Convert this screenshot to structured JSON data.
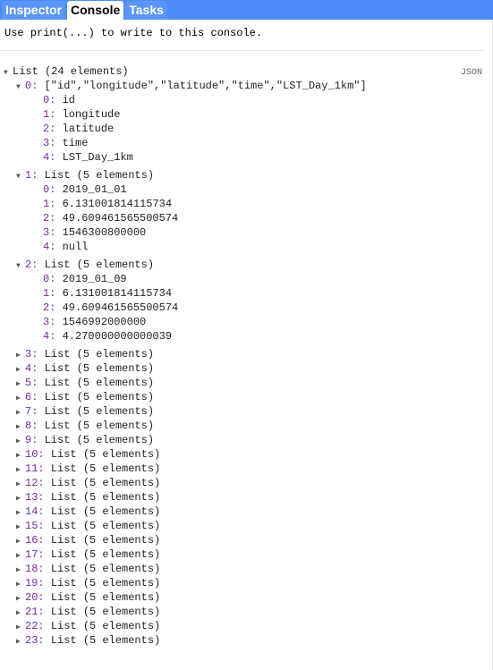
{
  "tabs": [
    {
      "label": "Inspector",
      "active": false
    },
    {
      "label": "Console",
      "active": true
    },
    {
      "label": "Tasks",
      "active": false
    }
  ],
  "help_text": "Use print(...) to write to this console.",
  "json_label": "JSON",
  "root": {
    "label": "List (24 elements)",
    "expanded": true
  },
  "items": [
    {
      "index": "0",
      "summary": "[\"id\",\"longitude\",\"latitude\",\"time\",\"LST_Day_1km\"]",
      "expanded": true,
      "children": [
        "id",
        "longitude",
        "latitude",
        "time",
        "LST_Day_1km"
      ]
    },
    {
      "index": "1",
      "summary": "List (5 elements)",
      "expanded": true,
      "children": [
        "2019_01_01",
        "6.131001814115734",
        "49.609461565500574",
        "1546300800000",
        "null"
      ]
    },
    {
      "index": "2",
      "summary": "List (5 elements)",
      "expanded": true,
      "children": [
        "2019_01_09",
        "6.131001814115734",
        "49.609461565500574",
        "1546992000000",
        "4.270000000000039"
      ]
    },
    {
      "index": "3",
      "summary": "List (5 elements)",
      "expanded": false
    },
    {
      "index": "4",
      "summary": "List (5 elements)",
      "expanded": false
    },
    {
      "index": "5",
      "summary": "List (5 elements)",
      "expanded": false
    },
    {
      "index": "6",
      "summary": "List (5 elements)",
      "expanded": false
    },
    {
      "index": "7",
      "summary": "List (5 elements)",
      "expanded": false
    },
    {
      "index": "8",
      "summary": "List (5 elements)",
      "expanded": false
    },
    {
      "index": "9",
      "summary": "List (5 elements)",
      "expanded": false
    },
    {
      "index": "10",
      "summary": "List (5 elements)",
      "expanded": false
    },
    {
      "index": "11",
      "summary": "List (5 elements)",
      "expanded": false
    },
    {
      "index": "12",
      "summary": "List (5 elements)",
      "expanded": false
    },
    {
      "index": "13",
      "summary": "List (5 elements)",
      "expanded": false
    },
    {
      "index": "14",
      "summary": "List (5 elements)",
      "expanded": false
    },
    {
      "index": "15",
      "summary": "List (5 elements)",
      "expanded": false
    },
    {
      "index": "16",
      "summary": "List (5 elements)",
      "expanded": false
    },
    {
      "index": "17",
      "summary": "List (5 elements)",
      "expanded": false
    },
    {
      "index": "18",
      "summary": "List (5 elements)",
      "expanded": false
    },
    {
      "index": "19",
      "summary": "List (5 elements)",
      "expanded": false
    },
    {
      "index": "20",
      "summary": "List (5 elements)",
      "expanded": false
    },
    {
      "index": "21",
      "summary": "List (5 elements)",
      "expanded": false
    },
    {
      "index": "22",
      "summary": "List (5 elements)",
      "expanded": false
    },
    {
      "index": "23",
      "summary": "List (5 elements)",
      "expanded": false
    }
  ]
}
